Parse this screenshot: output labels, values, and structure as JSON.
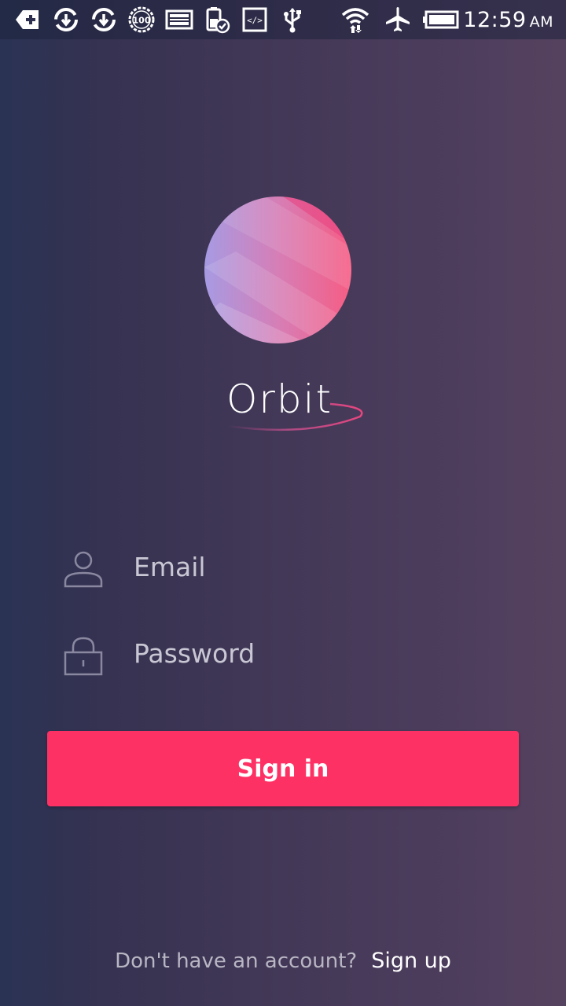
{
  "status_bar": {
    "time": "12:59",
    "ampm": "AM",
    "icons": [
      "add-notification-icon",
      "sync-icon",
      "sync-icon",
      "battery-100-icon",
      "image-icon",
      "battery-check-icon",
      "developer-code-icon",
      "usb-icon",
      "wifi-icon",
      "airplane-icon",
      "battery-icon"
    ]
  },
  "brand": {
    "name": "Orbit"
  },
  "form": {
    "email_placeholder": "Email",
    "password_placeholder": "Password",
    "signin_label": "Sign in"
  },
  "footer": {
    "prompt": "Don't have an account?",
    "signup_label": "Sign up"
  },
  "colors": {
    "accent": "#fe3165",
    "background_left": "#2a3354",
    "background_right": "#55425f"
  }
}
